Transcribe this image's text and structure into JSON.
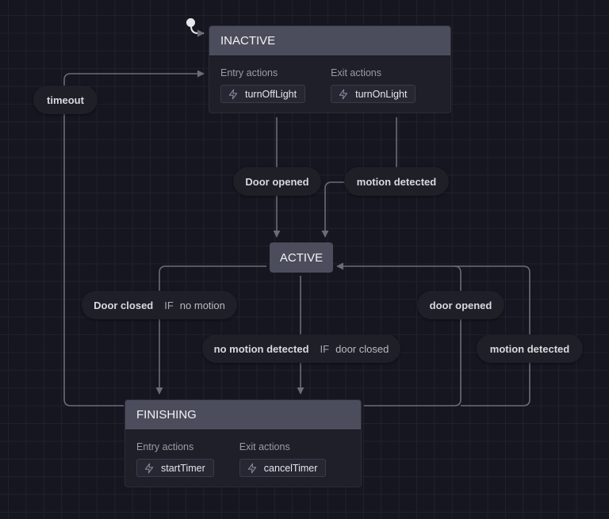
{
  "diagram": {
    "type": "state-machine",
    "initial_state": "INACTIVE",
    "colors": {
      "background": "#151620",
      "grid": "#20212b",
      "state_header": "#4c4d5c",
      "state_body": "#1e1f29",
      "edge": "#6b6c7a",
      "event_pill": "#1e1f27"
    },
    "labels": {
      "entry_actions": "Entry actions",
      "exit_actions": "Exit actions",
      "if": "IF"
    },
    "states": {
      "inactive": {
        "name": "INACTIVE",
        "entry_actions": [
          "turnOffLight"
        ],
        "exit_actions": [
          "turnOnLight"
        ],
        "action_icon": "bolt-icon"
      },
      "active": {
        "name": "ACTIVE"
      },
      "finishing": {
        "name": "FINISHING",
        "entry_actions": [
          "startTimer"
        ],
        "exit_actions": [
          "cancelTimer"
        ],
        "action_icon": "bolt-icon"
      }
    },
    "transitions": [
      {
        "event": "timeout",
        "from": "FINISHING",
        "to": "INACTIVE",
        "guard": ""
      },
      {
        "event": "Door opened",
        "from": "INACTIVE",
        "to": "ACTIVE",
        "guard": ""
      },
      {
        "event": "motion detected",
        "from": "INACTIVE",
        "to": "ACTIVE",
        "guard": ""
      },
      {
        "event": "Door closed",
        "from": "ACTIVE",
        "to": "FINISHING",
        "guard": "no motion"
      },
      {
        "event": "no motion detected",
        "from": "ACTIVE",
        "to": "FINISHING",
        "guard": "door closed"
      },
      {
        "event": "door opened",
        "from": "FINISHING",
        "to": "ACTIVE",
        "guard": ""
      },
      {
        "event": "motion detected",
        "from": "FINISHING",
        "to": "ACTIVE",
        "guard": ""
      }
    ]
  }
}
